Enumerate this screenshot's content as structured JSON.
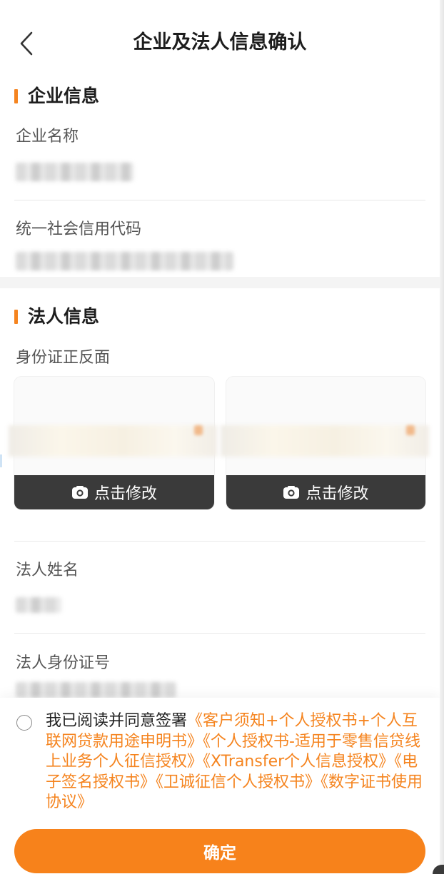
{
  "header": {
    "title": "企业及法人信息确认",
    "back_icon": "chevron-left-icon"
  },
  "company_section": {
    "title": "企业信息",
    "name_label": "企业名称",
    "credit_code_label": "统一社会信用代码"
  },
  "legal_section": {
    "title": "法人信息",
    "id_card_label": "身份证正反面",
    "id_cards": [
      {
        "action_label": "点击修改",
        "icon": "camera-icon"
      },
      {
        "action_label": "点击修改",
        "icon": "camera-icon"
      }
    ],
    "name_label": "法人姓名",
    "id_number_label": "法人身份证号"
  },
  "agreement": {
    "checked": false,
    "prefix": "我已阅读并同意签署",
    "documents": [
      "《客户须知+个人授权书+个人互联网贷款用途申明书》",
      "《个人授权书-适用于零售信贷线上业务个人征信授权》",
      "《XTransfer个人信息授权》",
      "《电子签名授权书》",
      "《卫诚征信个人授权书》",
      "《数字证书使用协议》"
    ]
  },
  "confirm_button": {
    "label": "确定"
  },
  "colors": {
    "accent": "#F5841F",
    "button": "#F7821B",
    "text_primary": "#1d1d1d",
    "text_secondary": "#555555",
    "action_bar": "#3a3a3a"
  }
}
